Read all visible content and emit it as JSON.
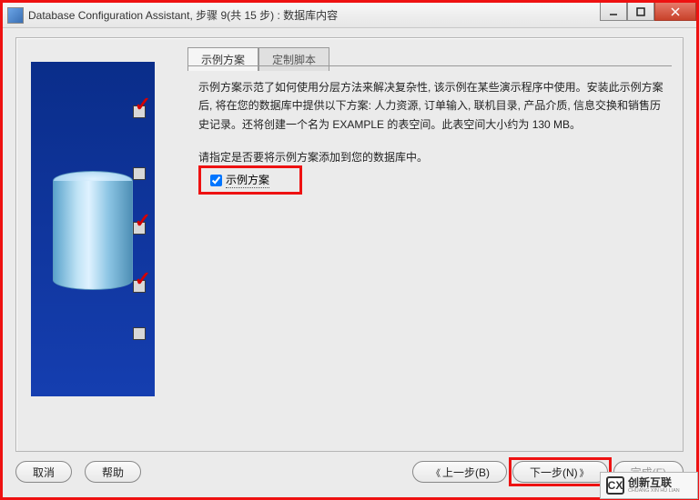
{
  "window": {
    "title": "Database Configuration Assistant, 步骤 9(共 15 步) : 数据库内容"
  },
  "tabs": {
    "active": "示例方案",
    "inactive": "定制脚本"
  },
  "description": "示例方案示范了如何使用分层方法来解决复杂性, 该示例在某些演示程序中使用。安装此示例方案后, 将在您的数据库中提供以下方案: 人力资源, 订单输入, 联机目录, 产品介质, 信息交换和销售历史记录。还将创建一个名为 EXAMPLE 的表空间。此表空间大小约为 130 MB。",
  "prompt": "请指定是否要将示例方案添加到您的数据库中。",
  "option": {
    "label": "示例方案",
    "checked": true
  },
  "buttons": {
    "cancel": "取消",
    "help": "帮助",
    "back": "上一步(B)",
    "next": "下一步(N)",
    "finish": "完成(F)"
  },
  "watermark": {
    "brand_cn": "创新互联",
    "brand_en": "CHUANG XIN HU LIAN"
  }
}
